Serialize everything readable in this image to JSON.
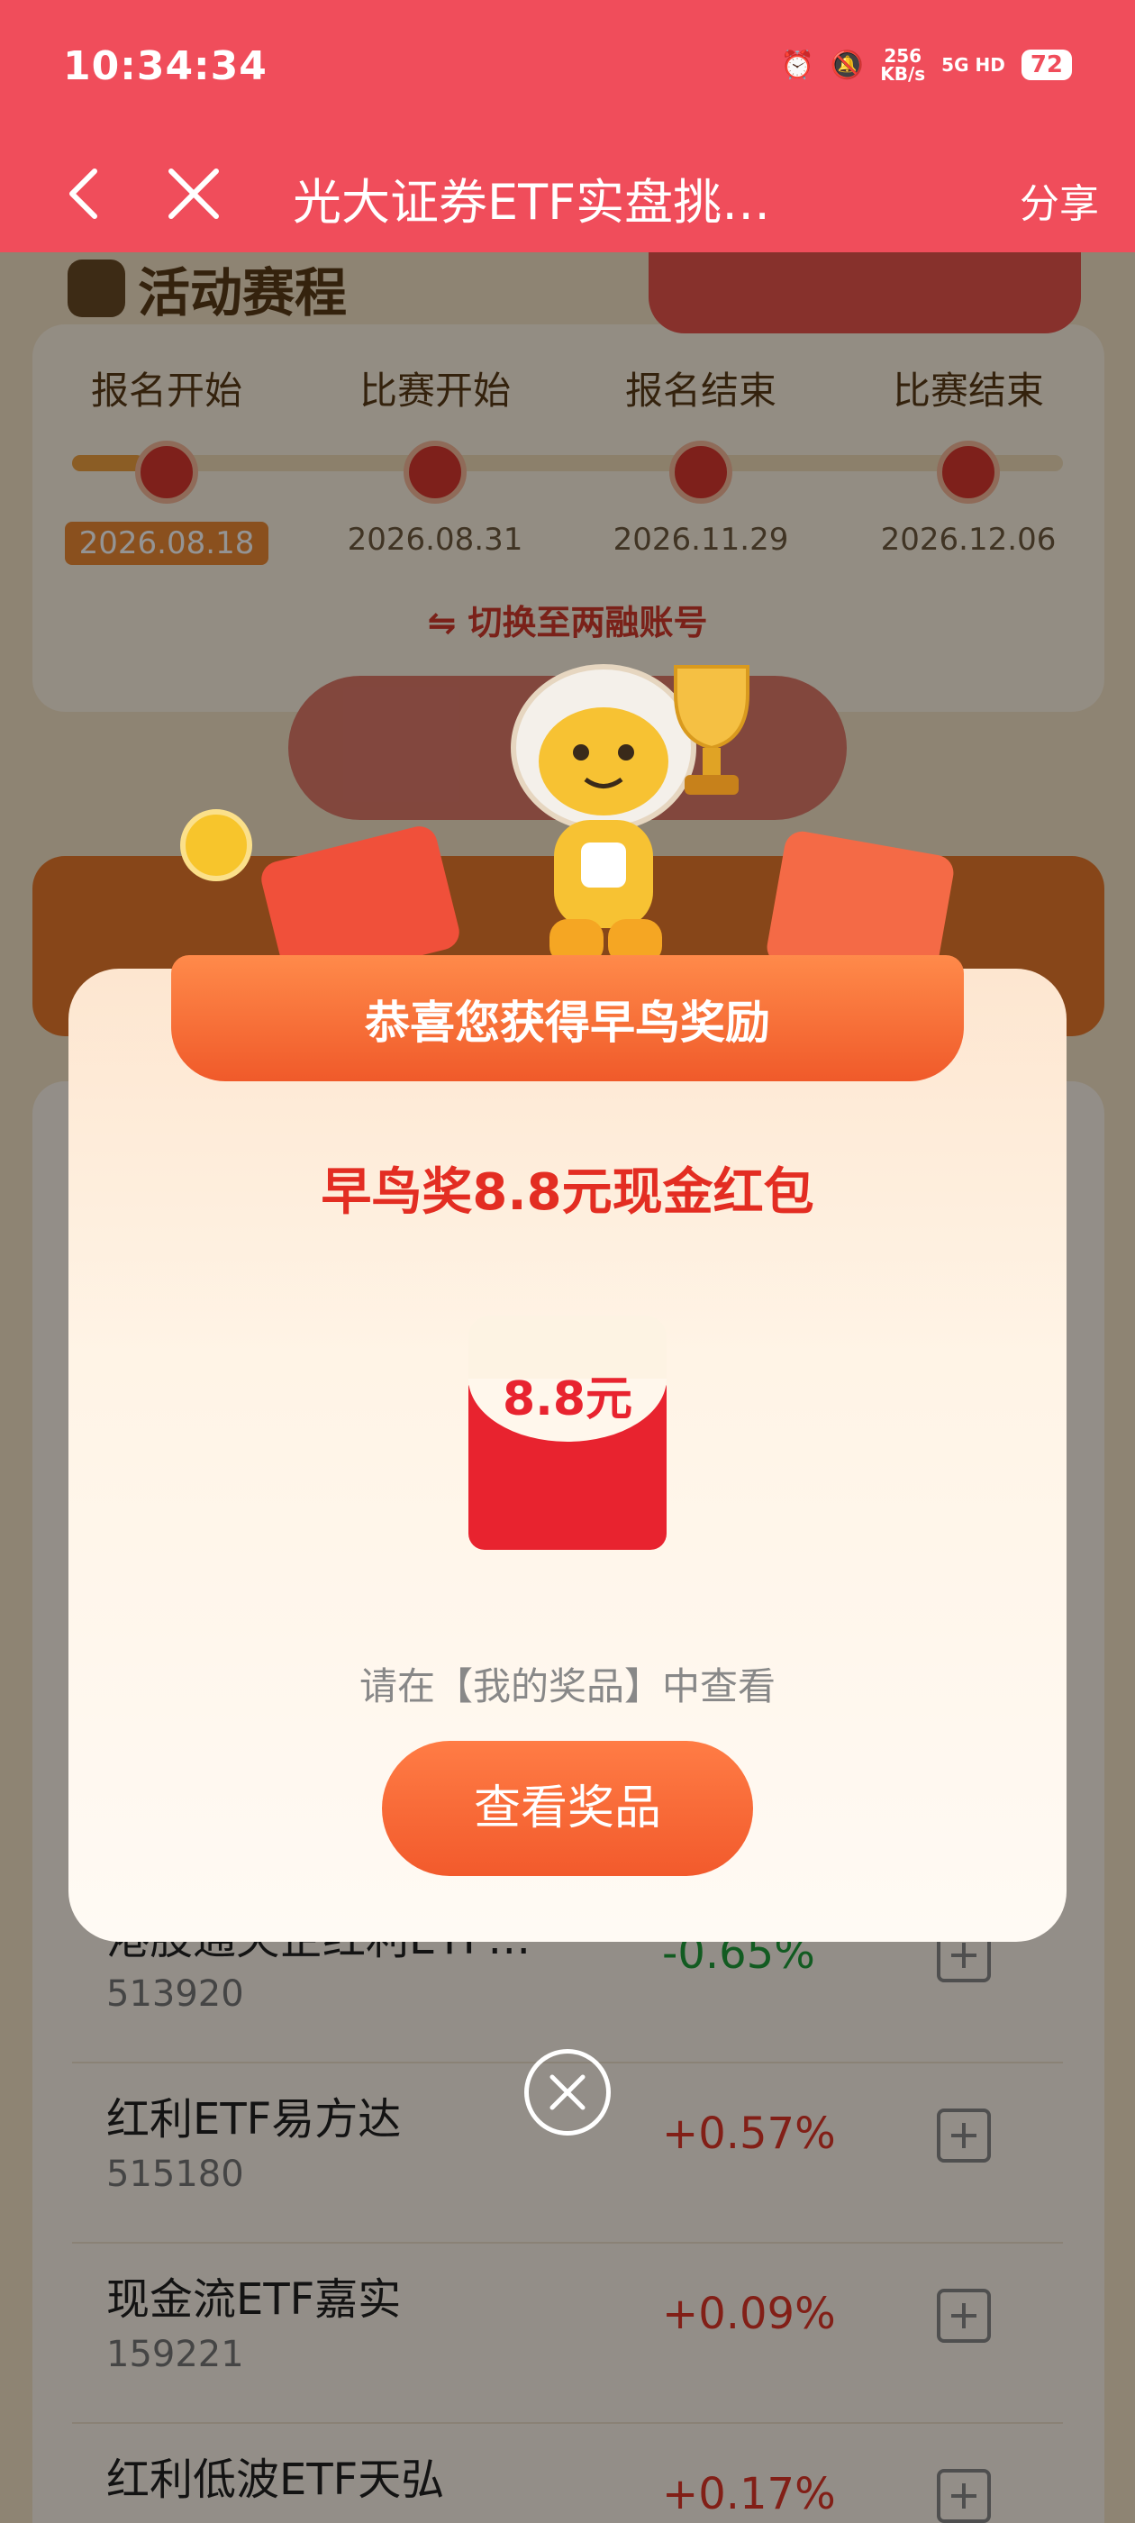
{
  "status_bar": {
    "time": "10:34:34",
    "net_speed": "256",
    "net_unit": "KB/s",
    "signal": "5G HD",
    "battery": "72"
  },
  "nav": {
    "title": "光大证券ETF实盘挑…",
    "share_label": "分享"
  },
  "schedule": {
    "title": "活动赛程",
    "stages": [
      {
        "label": "报名开始",
        "date": "2026.08.18",
        "active": true
      },
      {
        "label": "比赛开始",
        "date": "2026.08.31",
        "active": false
      },
      {
        "label": "报名结束",
        "date": "2026.11.29",
        "active": false
      },
      {
        "label": "比赛结束",
        "date": "2026.12.06",
        "active": false
      }
    ],
    "switch_label": "⇋ 切换至两融账号"
  },
  "funds": [
    {
      "name": "港股通央企红利ETF…",
      "code": "513920",
      "change": "-0.65%",
      "direction": "down"
    },
    {
      "name": "红利ETF易方达",
      "code": "515180",
      "change": "+0.57%",
      "direction": "up"
    },
    {
      "name": "现金流ETF嘉实",
      "code": "159221",
      "change": "+0.09%",
      "direction": "up"
    },
    {
      "name": "红利低波ETF天弘",
      "code": "",
      "change": "+0.17%",
      "direction": "up"
    }
  ],
  "modal": {
    "banner": "恭喜您获得早鸟奖励",
    "award_title": "早鸟奖8.8元现金红包",
    "envelope_amount": "8.8元",
    "hint": "请在【我的奖品】中查看",
    "view_button": "查看奖品"
  },
  "colors": {
    "brand_red": "#f04d5b",
    "accent_orange": "#f25a2c",
    "up": "#e03628",
    "down": "#1f9d3a"
  }
}
